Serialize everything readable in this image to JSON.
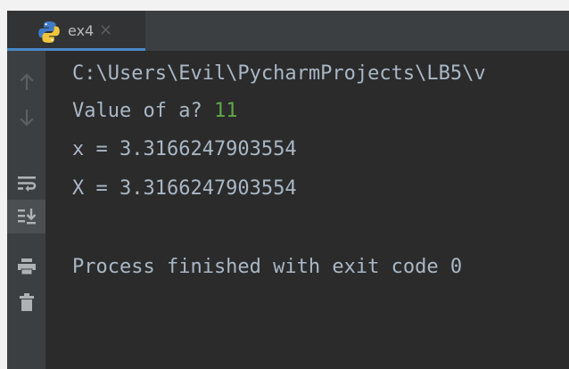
{
  "tab": {
    "label": "ex4",
    "close_glyph": "×",
    "icon": "python-icon"
  },
  "gutter": {
    "buttons": [
      {
        "name": "up-arrow-icon",
        "label": "Up the Stack Trace"
      },
      {
        "name": "down-arrow-icon",
        "label": "Down the Stack Trace"
      },
      {
        "name": "soft-wrap-icon",
        "label": "Soft-Wrap"
      },
      {
        "name": "scroll-to-end-icon",
        "label": "Scroll to the End"
      },
      {
        "name": "print-icon",
        "label": "Print"
      },
      {
        "name": "trash-icon",
        "label": "Clear All"
      }
    ]
  },
  "console": {
    "path": "C:\\Users\\Evil\\PycharmProjects\\LB5\\v",
    "prompt": "Value of a? ",
    "input_value": "11",
    "line1": "x = 3.3166247903554",
    "line2": "X = 3.3166247903554",
    "exit_message": "Process finished with exit code 0"
  },
  "colors": {
    "background": "#2b2b2b",
    "text": "#a9b7c6",
    "input": "#5fa84a",
    "toolbar": "#3c3f41",
    "accent": "#4a88c7"
  }
}
